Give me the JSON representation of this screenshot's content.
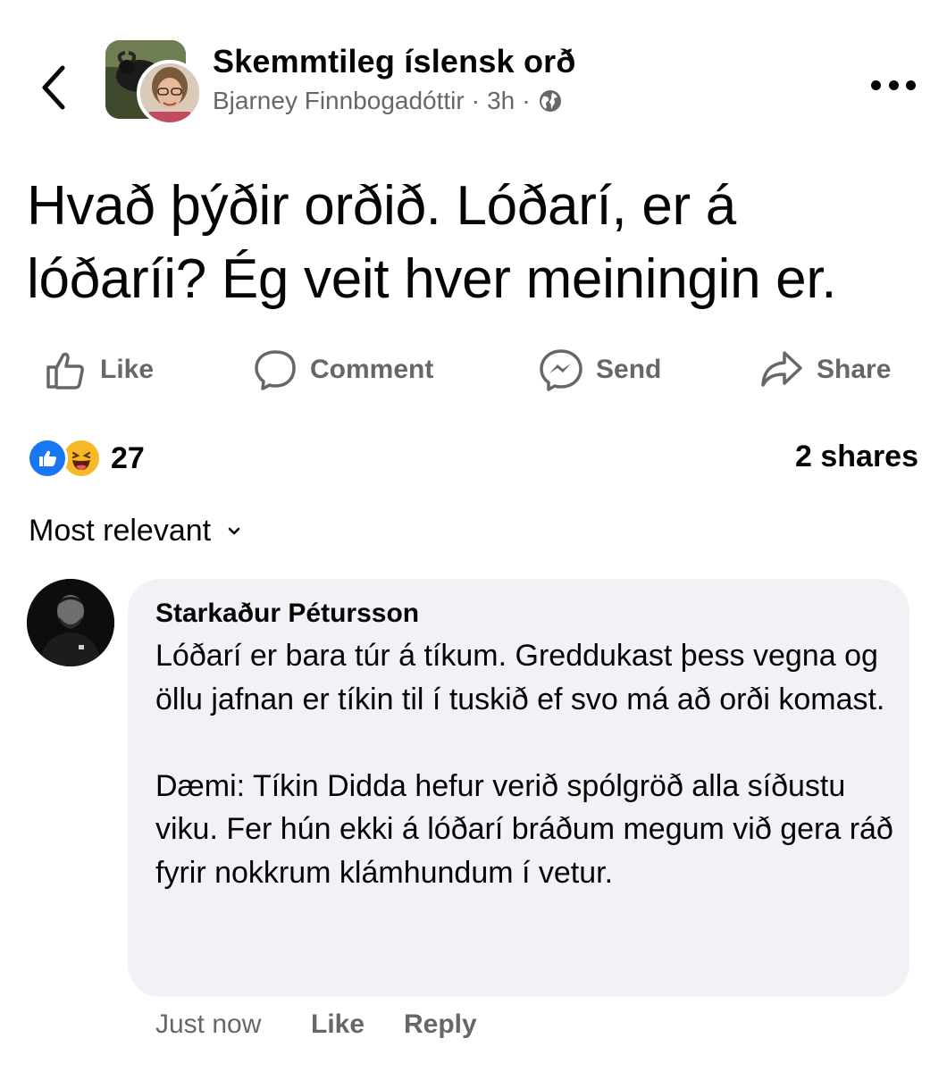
{
  "header": {
    "group_name": "Skemmtileg íslensk orð",
    "author": "Bjarney Finnbogadóttir",
    "time": "3h",
    "separator": "·",
    "audience_icon": "globe-icon"
  },
  "post": {
    "line1": "Hvað þýðir orðið. Lóðarí, er á",
    "line2": "lóðaríi? Ég veit hver meiningin er."
  },
  "actions": {
    "like": "Like",
    "comment": "Comment",
    "send": "Send",
    "share": "Share"
  },
  "stats": {
    "reaction_count": "27",
    "reaction_icons": [
      "like-reaction-icon",
      "haha-reaction-icon"
    ],
    "shares": "2 shares"
  },
  "sort": {
    "label": "Most relevant"
  },
  "comment": {
    "author": "Starkaður Pétursson",
    "paragraph1": "Lóðarí er bara túr á tíkum. Greddukast þess vegna og öllu jafnan er tíkin til í tuskið ef svo má að orði komast.",
    "paragraph2": "Dæmi: Tíkin Didda hefur verið spólgröð alla síðustu viku. Fer hún ekki á lóðarí bráðum megum við gera ráð fyrir nokkrum klámhundum í vetur.",
    "time": "Just now",
    "like": "Like",
    "reply": "Reply"
  },
  "colors": {
    "text": "#050505",
    "secondary": "#65676b",
    "bubble": "#f0f2f5",
    "like_blue": "#1877f2",
    "haha_yellow": "#f7b928"
  }
}
